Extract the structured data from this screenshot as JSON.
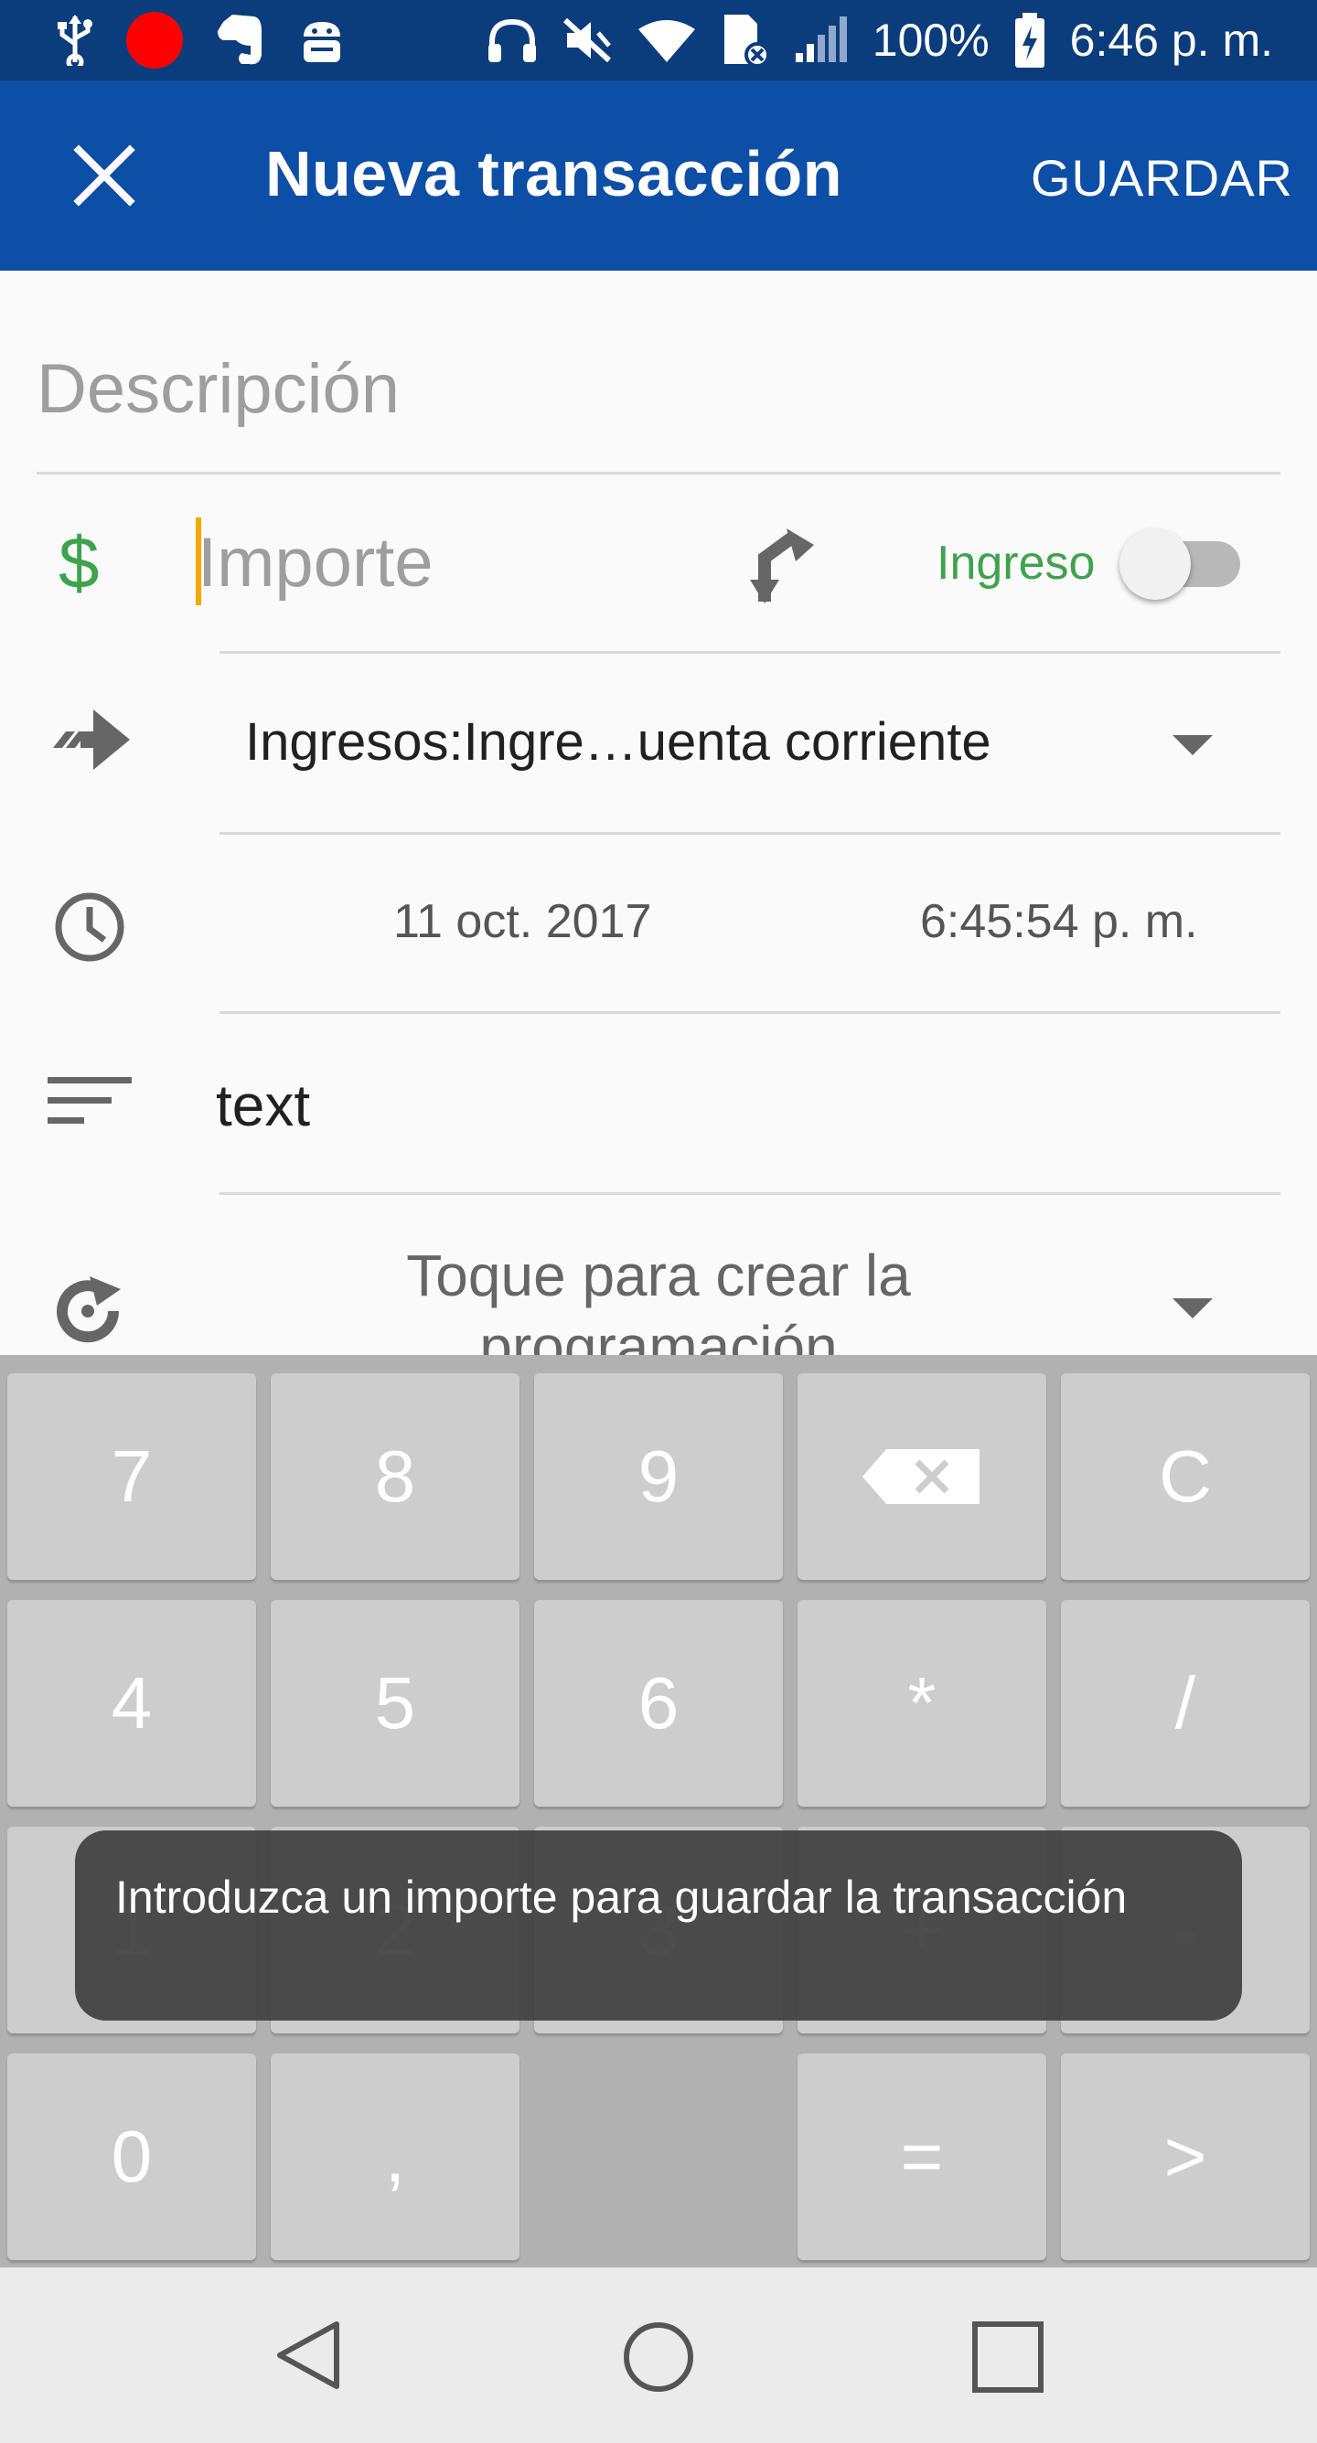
{
  "status_bar": {
    "battery": "100%",
    "time": "6:46 p. m.",
    "icons": [
      "usb-icon",
      "record-dot-icon",
      "evernote-icon",
      "android-debug-icon",
      "headphones-icon",
      "mute-icon",
      "wifi-icon",
      "sim-icon",
      "signal-icon",
      "battery-charging-icon"
    ]
  },
  "app_bar": {
    "title": "Nueva transacción",
    "save_label": "GUARDAR"
  },
  "form": {
    "description_placeholder": "Descripción",
    "currency_symbol": "$",
    "amount_placeholder": "Importe",
    "type_label": "Ingreso",
    "type_enabled": false,
    "account": "Ingresos:Ingre…uenta corriente",
    "date": "11 oct. 2017",
    "time": "6:45:54 p. m.",
    "notes": "text",
    "schedule_placeholder": "Toque para crear la programación"
  },
  "keypad": {
    "rows": [
      [
        "7",
        "8",
        "9",
        "⌫",
        "C"
      ],
      [
        "4",
        "5",
        "6",
        "*",
        "/"
      ],
      [
        "1",
        "2",
        "3",
        "+",
        "-"
      ],
      [
        "0",
        ",",
        "",
        "=",
        ">"
      ]
    ]
  },
  "toast": {
    "message": "Introduzca un importe para guardar la transacción"
  },
  "colors": {
    "status_bar": "#0b3d7c",
    "app_bar": "#0d4ea6",
    "income_green": "#3fa34d",
    "cursor": "#f5a800"
  }
}
